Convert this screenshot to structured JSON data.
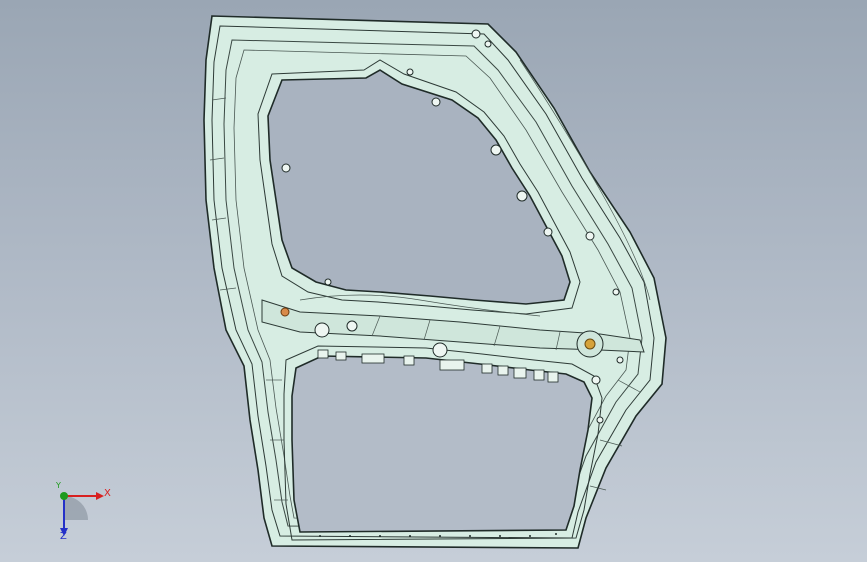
{
  "viewport": {
    "background_top": "#9aa6b4",
    "background_bottom": "#c6ced8",
    "model_color": "#d7ede3",
    "edge_color": "#1f2b28"
  },
  "model": {
    "name": "door-inner-panel"
  },
  "triad": {
    "x_label": "X",
    "y_label": "Y",
    "z_label": "Z",
    "x_color": "#d82020",
    "y_color": "#1e9a1e",
    "z_color": "#2430c8"
  }
}
